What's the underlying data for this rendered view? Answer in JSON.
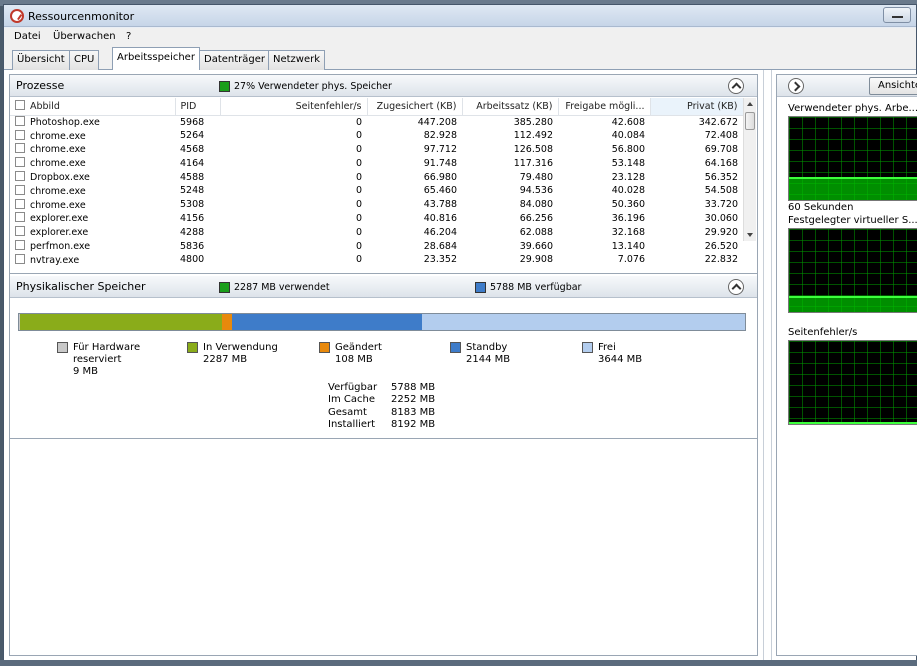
{
  "window": {
    "title": "Ressourcenmonitor"
  },
  "menu": [
    "Datei",
    "Überwachen",
    "?"
  ],
  "tabs": [
    "Übersicht",
    "CPU",
    "Arbeitsspeicher",
    "Datenträger",
    "Netzwerk"
  ],
  "active_tab": "Arbeitsspeicher",
  "processes": {
    "title": "Prozesse",
    "summary": "27% Verwendeter phys. Speicher",
    "summary_color": "#1a9e1a",
    "columns": [
      "Abbild",
      "PID",
      "Seitenfehler/s",
      "Zugesichert (KB)",
      "Arbeitssatz (KB)",
      "Freigabe mögli...",
      "Privat (KB)"
    ],
    "rows": [
      [
        "Photoshop.exe",
        "5968",
        "0",
        "447.208",
        "385.280",
        "42.608",
        "342.672"
      ],
      [
        "chrome.exe",
        "5264",
        "0",
        "82.928",
        "112.492",
        "40.084",
        "72.408"
      ],
      [
        "chrome.exe",
        "4568",
        "0",
        "97.712",
        "126.508",
        "56.800",
        "69.708"
      ],
      [
        "chrome.exe",
        "4164",
        "0",
        "91.748",
        "117.316",
        "53.148",
        "64.168"
      ],
      [
        "Dropbox.exe",
        "4588",
        "0",
        "66.980",
        "79.480",
        "23.128",
        "56.352"
      ],
      [
        "chrome.exe",
        "5248",
        "0",
        "65.460",
        "94.536",
        "40.028",
        "54.508"
      ],
      [
        "chrome.exe",
        "5308",
        "0",
        "43.788",
        "84.080",
        "50.360",
        "33.720"
      ],
      [
        "explorer.exe",
        "4156",
        "0",
        "40.816",
        "66.256",
        "36.196",
        "30.060"
      ],
      [
        "explorer.exe",
        "4288",
        "0",
        "46.204",
        "62.088",
        "32.168",
        "29.920"
      ],
      [
        "perfmon.exe",
        "5836",
        "0",
        "28.684",
        "39.660",
        "13.140",
        "26.520"
      ],
      [
        "nvtray.exe",
        "4800",
        "0",
        "23.352",
        "29.908",
        "7.076",
        "22.832"
      ]
    ]
  },
  "physical": {
    "title": "Physikalischer Speicher",
    "used_summary": "2287 MB verwendet",
    "avail_summary": "5788 MB verfügbar",
    "used_color": "#1a9e1a",
    "avail_color": "#3e7cc9",
    "bar_segments": [
      {
        "name": "Für Hardware reserviert",
        "mb": 9,
        "color": "#c8c8c8"
      },
      {
        "name": "In Verwendung",
        "mb": 2287,
        "color": "#8aac1a"
      },
      {
        "name": "Geändert",
        "mb": 108,
        "color": "#e8890c"
      },
      {
        "name": "Standby",
        "mb": 2144,
        "color": "#3e7cc9"
      },
      {
        "name": "Frei",
        "mb": 3644,
        "color": "#b3cdee"
      }
    ],
    "legend": [
      {
        "label": "Für Hardware",
        "label2": "reserviert",
        "value": "9 MB"
      },
      {
        "label": "In Verwendung",
        "value": "2287 MB"
      },
      {
        "label": "Geändert",
        "value": "108 MB"
      },
      {
        "label": "Standby",
        "value": "2144 MB"
      },
      {
        "label": "Frei",
        "value": "3644 MB"
      }
    ],
    "stats": [
      {
        "k": "Verfügbar",
        "v": "5788 MB"
      },
      {
        "k": "Im Cache",
        "v": "2252 MB"
      },
      {
        "k": "Gesamt",
        "v": "8183 MB"
      },
      {
        "k": "Installiert",
        "v": "8192 MB"
      }
    ]
  },
  "right": {
    "view_button": "Ansichten",
    "graph1_label": "Verwendeter phys. Arbe...",
    "graph1_time": "60 Sekunden",
    "graph2_label": "Festgelegter virtueller S...",
    "graph3_label": "Seitenfehler/s"
  }
}
